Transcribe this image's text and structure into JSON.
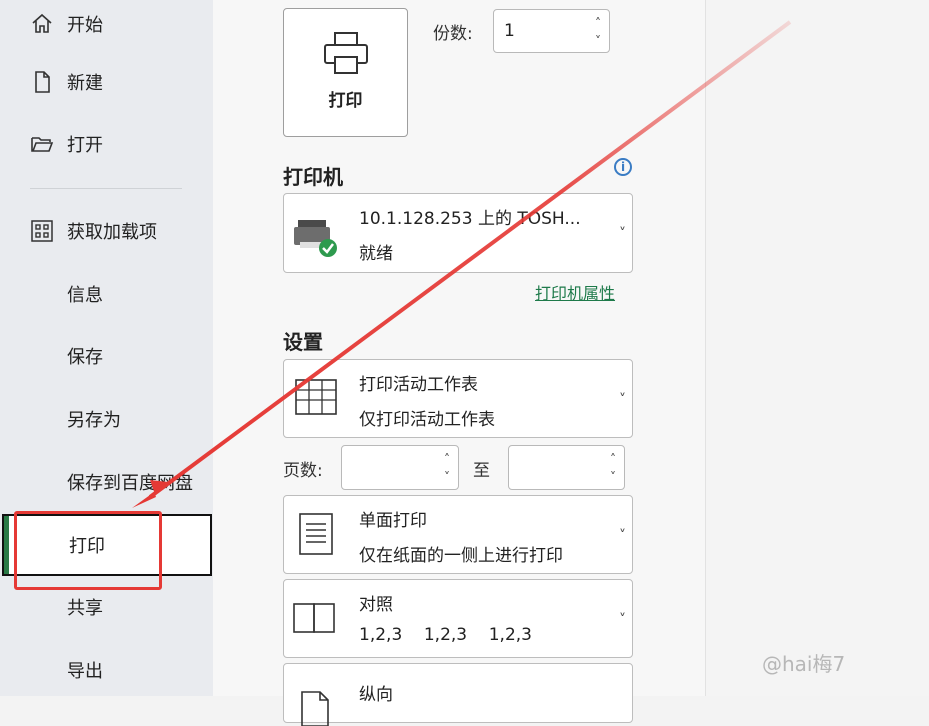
{
  "sidebar": {
    "items": [
      {
        "label": "开始",
        "icon": "home-icon"
      },
      {
        "label": "新建",
        "icon": "new-document-icon"
      },
      {
        "label": "打开",
        "icon": "folder-open-icon"
      },
      {
        "label": "获取加载项",
        "icon": "apps-grid-icon"
      },
      {
        "label": "信息"
      },
      {
        "label": "保存"
      },
      {
        "label": "另存为"
      },
      {
        "label": "保存到百度网盘"
      },
      {
        "label": "打印"
      },
      {
        "label": "共享"
      },
      {
        "label": "导出"
      }
    ],
    "selected": "打印"
  },
  "print": {
    "button_label": "打印",
    "copies_label": "份数:",
    "copies_value": "1"
  },
  "printer": {
    "section_title": "打印机",
    "name": "10.1.128.253 上的 TOSH...",
    "status": "就绪",
    "properties_link": "打印机属性"
  },
  "settings": {
    "section_title": "设置",
    "scope_title": "打印活动工作表",
    "scope_sub": "仅打印活动工作表",
    "pages_label": "页数:",
    "pages_from": "",
    "pages_to_label": "至",
    "pages_to": "",
    "sides_title": "单面打印",
    "sides_sub": "仅在纸面的一侧上进行打印",
    "collate_title": "对照",
    "collate_sub": "1,2,3    1,2,3    1,2,3",
    "orientation_title": "纵向"
  },
  "watermark": "@hai梅7",
  "colors": {
    "accent_green": "#2a7a46",
    "annotation_red": "#e53935",
    "link_green": "#1e7a4a"
  }
}
